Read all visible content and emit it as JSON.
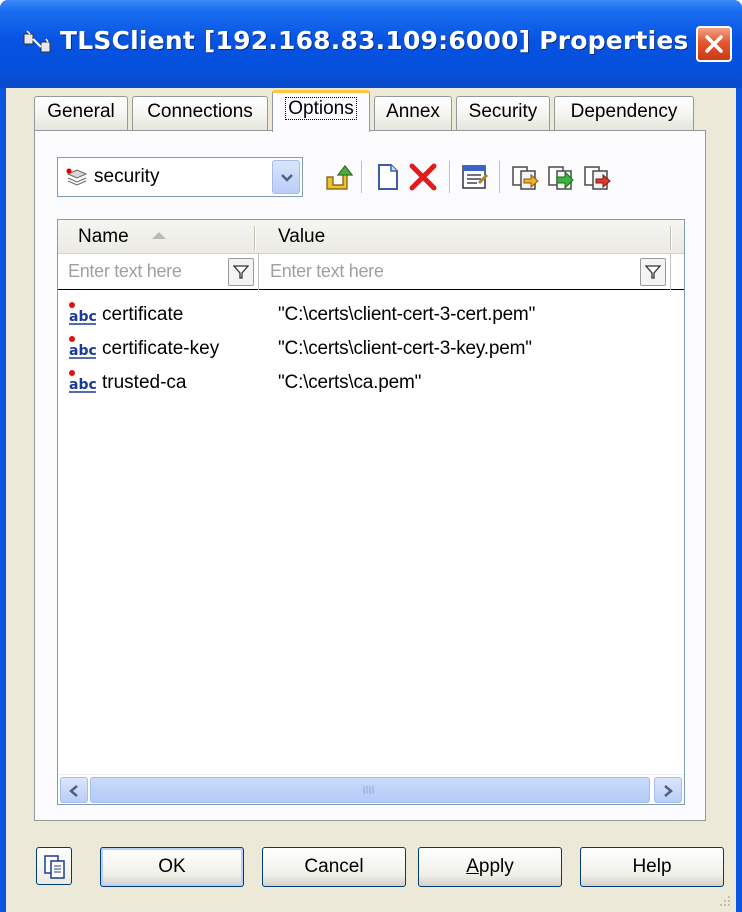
{
  "window": {
    "title": "TLSClient [192.168.83.109:6000] Properties"
  },
  "tabs": [
    {
      "label": "General"
    },
    {
      "label": "Connections"
    },
    {
      "label": "Options"
    },
    {
      "label": "Annex"
    },
    {
      "label": "Security"
    },
    {
      "label": "Dependency"
    }
  ],
  "active_tab": "Options",
  "toolbar": {
    "section_combo_value": "security",
    "icons": [
      "go-up-icon",
      "new-document-icon",
      "delete-icon",
      "properties-icon",
      "copy-icon",
      "import-icon",
      "export-icon"
    ]
  },
  "list": {
    "columns": [
      {
        "label": "Name"
      },
      {
        "label": "Value"
      }
    ],
    "filters": {
      "name_placeholder": "Enter text here",
      "value_placeholder": "Enter text here"
    },
    "rows": [
      {
        "name": "certificate",
        "value": "\"C:\\certs\\client-cert-3-cert.pem\""
      },
      {
        "name": "certificate-key",
        "value": "\"C:\\certs\\client-cert-3-key.pem\""
      },
      {
        "name": "trusted-ca",
        "value": "\"C:\\certs\\ca.pem\""
      }
    ]
  },
  "buttons": {
    "ok": "OK",
    "cancel": "Cancel",
    "apply_prefix": "",
    "apply_underlined": "A",
    "apply_rest": "pply",
    "help": "Help"
  },
  "colors": {
    "titlebar": "#0754e3",
    "dialog_bg": "#ece9d8",
    "close_red": "#e4572f",
    "active_tab_accent": "#ffc83c"
  }
}
